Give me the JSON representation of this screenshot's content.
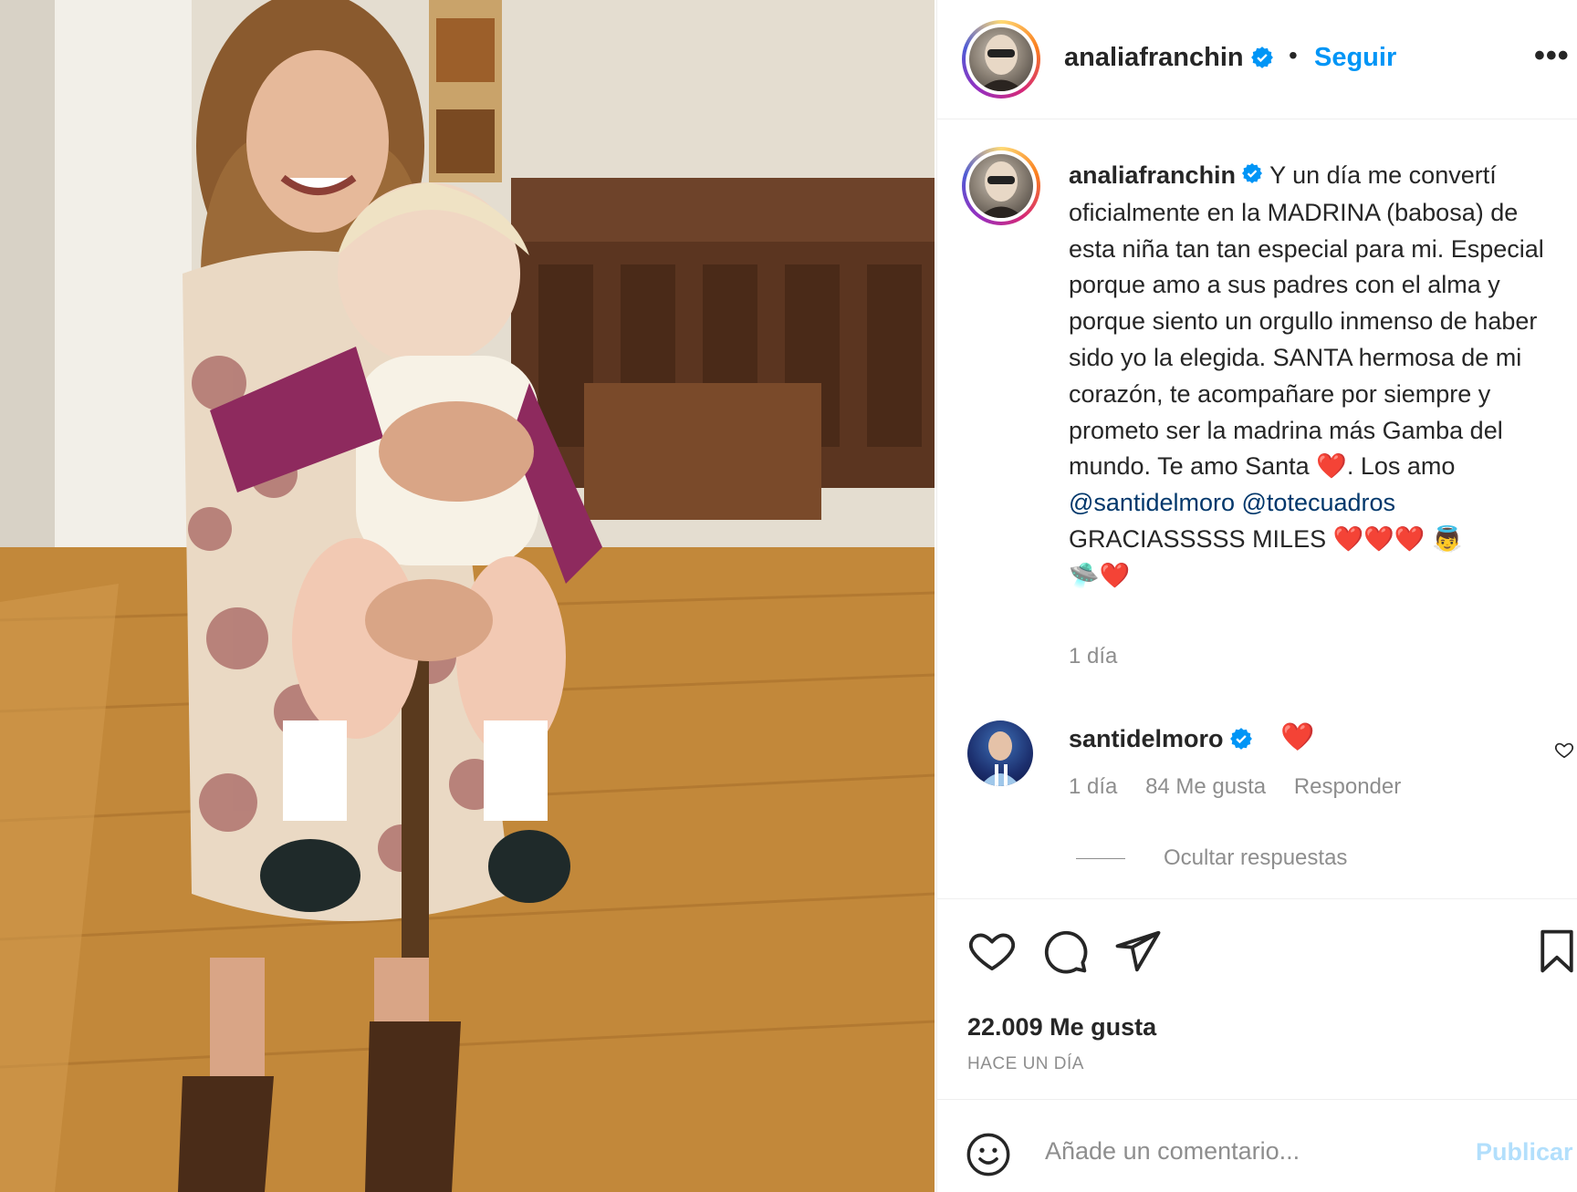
{
  "header": {
    "username": "analiafranchin",
    "separator": "•",
    "follow_label": "Seguir",
    "more_label": "•••"
  },
  "caption": {
    "username": "analiafranchin",
    "text": " Y un día me convertí oficialmente en la MADRINA (babosa) de esta niña tan tan especial para mi. Especial porque amo a sus padres con el alma y porque siento un orgullo inmenso de haber sido yo la elegida. SANTA hermosa de mi corazón, te acompañare por siempre y prometo ser la madrina más Gamba del mundo. Te amo Santa ",
    "heart": "❤️",
    "text2": ". Los amo ",
    "mention1": "@santidelmoro",
    "mention2": "@totecuadros",
    "closing": "GRACIASSSSS MILES ",
    "hearts": "❤️❤️❤️ ",
    "emoji_tail": "👼",
    "emoji_tail2": "🛸❤️",
    "time": "1 día"
  },
  "comment": {
    "username": "santidelmoro",
    "text": "❤️",
    "time": "1 día",
    "likes": "84 Me gusta",
    "reply_label": "Responder",
    "hide_replies_label": "Ocultar respuestas"
  },
  "actions": {
    "likes_count": "22.009 Me gusta",
    "date": "HACE UN DÍA"
  },
  "add_comment": {
    "placeholder": "Añade un comentario...",
    "publish_label": "Publicar"
  },
  "colors": {
    "accent": "#0095f6",
    "verified": "#0095f6",
    "muted": "#8e8e8e",
    "heart": "#ed4956",
    "mention": "#00376b"
  },
  "icons": [
    "verified-badge-icon",
    "more-icon",
    "like-icon",
    "comment-icon",
    "share-icon",
    "save-icon",
    "emoji-icon",
    "comment-like-icon"
  ]
}
